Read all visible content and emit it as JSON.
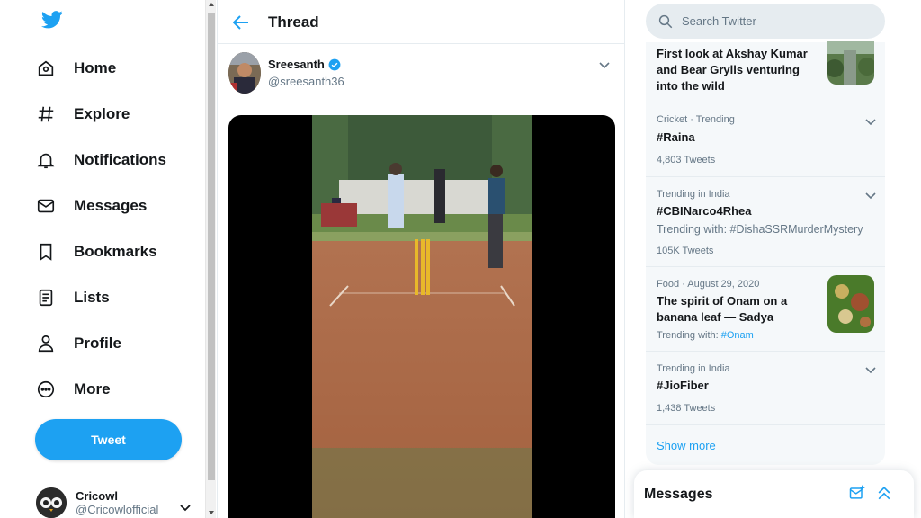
{
  "nav": {
    "items": [
      {
        "label": "Home",
        "icon": "home-icon"
      },
      {
        "label": "Explore",
        "icon": "hashtag-icon"
      },
      {
        "label": "Notifications",
        "icon": "bell-icon"
      },
      {
        "label": "Messages",
        "icon": "envelope-icon"
      },
      {
        "label": "Bookmarks",
        "icon": "bookmark-icon"
      },
      {
        "label": "Lists",
        "icon": "list-icon"
      },
      {
        "label": "Profile",
        "icon": "person-icon"
      },
      {
        "label": "More",
        "icon": "more-circle-icon"
      }
    ],
    "tweet_button": "Tweet",
    "account": {
      "name": "Cricowl",
      "handle": "@Cricowlofficial"
    }
  },
  "main": {
    "title": "Thread",
    "author": {
      "name": "Sreesanth",
      "handle": "@sreesanth36",
      "verified": true
    }
  },
  "right": {
    "search_placeholder": "Search Twitter",
    "trends": [
      {
        "title": "First look at Akshay Kumar and Bear Grylls venturing into the wild",
        "has_image": true
      },
      {
        "meta": "Cricket · Trending",
        "title": "#Raina",
        "count": "4,803 Tweets"
      },
      {
        "meta": "Trending in India",
        "title": "#CBINarco4Rhea",
        "sub": "Trending with: #DishaSSRMurderMystery",
        "count": "105K Tweets"
      },
      {
        "meta_cat": "Food",
        "meta_date": "August 29, 2020",
        "title": "The spirit of Onam on a banana leaf — Sadya",
        "trending_with_label": "Trending with:",
        "trending_with_tag": "#Onam",
        "has_image": true
      },
      {
        "meta": "Trending in India",
        "title": "#JioFiber",
        "count": "1,438 Tweets"
      }
    ],
    "show_more": "Show more",
    "messages_title": "Messages"
  },
  "colors": {
    "accent": "#1da1f2",
    "text": "#14171a",
    "muted": "#657786",
    "panel": "#f5f8fa"
  }
}
